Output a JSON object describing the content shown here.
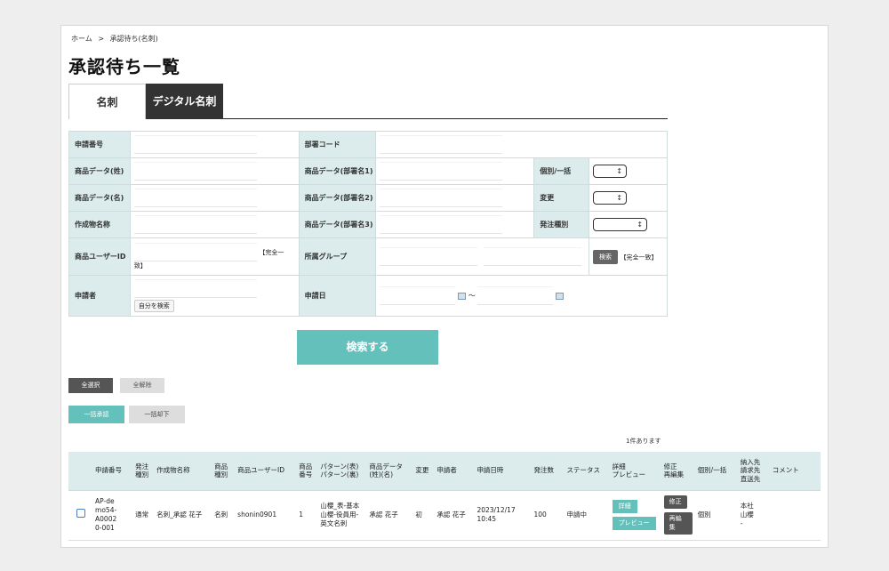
{
  "breadcrumb": {
    "home": "ホーム",
    "sep": ">",
    "current": "承認待ち(名刺)"
  },
  "page_title": "承認待ち一覧",
  "tabs": [
    {
      "label": "名刺"
    },
    {
      "label": "デジタル名刺"
    }
  ],
  "search": {
    "application_number": "申請番号",
    "department_code": "部署コード",
    "product_last_name": "商品データ(姓)",
    "product_dept1": "商品データ(部署名1)",
    "individual_bulk": "個別/一括",
    "product_first_name": "商品データ(名)",
    "product_dept2": "商品データ(部署名2)",
    "change": "変更",
    "creation_name": "作成物名称",
    "product_dept3": "商品データ(部署名3)",
    "order_type": "発注種別",
    "product_user_id": "商品ユーザーID",
    "exact_match_part1": "【完全一",
    "exact_match_part2": "致】",
    "group": "所属グループ",
    "search_small_button": "検索",
    "exact_match_full": "【完全一致】",
    "applicant": "申請者",
    "self_search_button": "自分を検索",
    "application_date": "申請日",
    "tilde": "～"
  },
  "buttons": {
    "search": "検索する",
    "select_all": "全選択",
    "clear_all": "全解除",
    "bulk_approve": "一括承認",
    "bulk_reject": "一括却下"
  },
  "result_count": "1件あります",
  "table": {
    "headers": [
      "",
      "申請番号",
      "発注\n種別",
      "作成物名称",
      "商品\n種別",
      "商品ユーザーID",
      "商品\n番号",
      "パターン(表)\nパターン(裏)",
      "商品データ\n(姓)(名)",
      "変更",
      "申請者",
      "申請日時",
      "発注数",
      "ステータス",
      "詳細\nプレビュー",
      "修正\n再編集",
      "個別/一括",
      "納入先\n請求先\n直送先",
      "コメント"
    ],
    "rows": [
      {
        "app_number": "AP-de\nmo54-\nA0002\n0-001",
        "order_type": "通常",
        "creation_name": "名刺_承認 花子",
        "product_type": "名刺",
        "user_id": "shonin0901",
        "product_no": "1",
        "pattern": "山櫻_表-基本\n山櫻-役員用-\n英文名刺",
        "product_name": "承認 花子",
        "change": "初",
        "applicant": "承認 花子",
        "date": "2023/12/17\n10:45",
        "quantity": "100",
        "status": "申請中",
        "detail_label": "詳細",
        "preview_label": "プレビュー",
        "fix_label": "修正",
        "reedit_label": "再編集",
        "individual": "個別",
        "delivery": "本社\n山櫻\n-",
        "comment": ""
      }
    ]
  }
}
